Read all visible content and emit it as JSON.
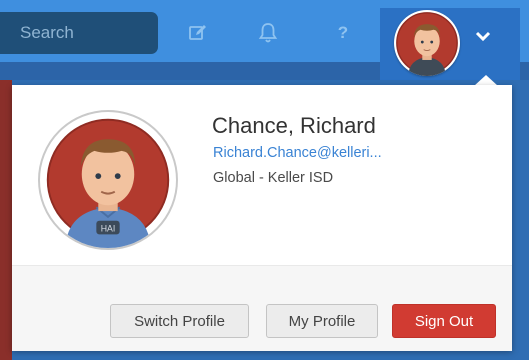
{
  "search": {
    "placeholder": "Search"
  },
  "header": {
    "icons": [
      "compose-icon",
      "bell-icon",
      "help-icon"
    ],
    "help_glyph": "?"
  },
  "user": {
    "name": "Chance, Richard",
    "email": "Richard.Chance@kelleri...",
    "org": "Global - Keller ISD",
    "avatar_shirt_text": "HAI"
  },
  "actions": {
    "switch_profile": "Switch Profile",
    "my_profile": "My Profile",
    "sign_out": "Sign Out"
  },
  "colors": {
    "topbar": "#3f8fdf",
    "search_bg": "#1f4f78",
    "link": "#3a83d4",
    "sign_out": "#d13b32"
  }
}
